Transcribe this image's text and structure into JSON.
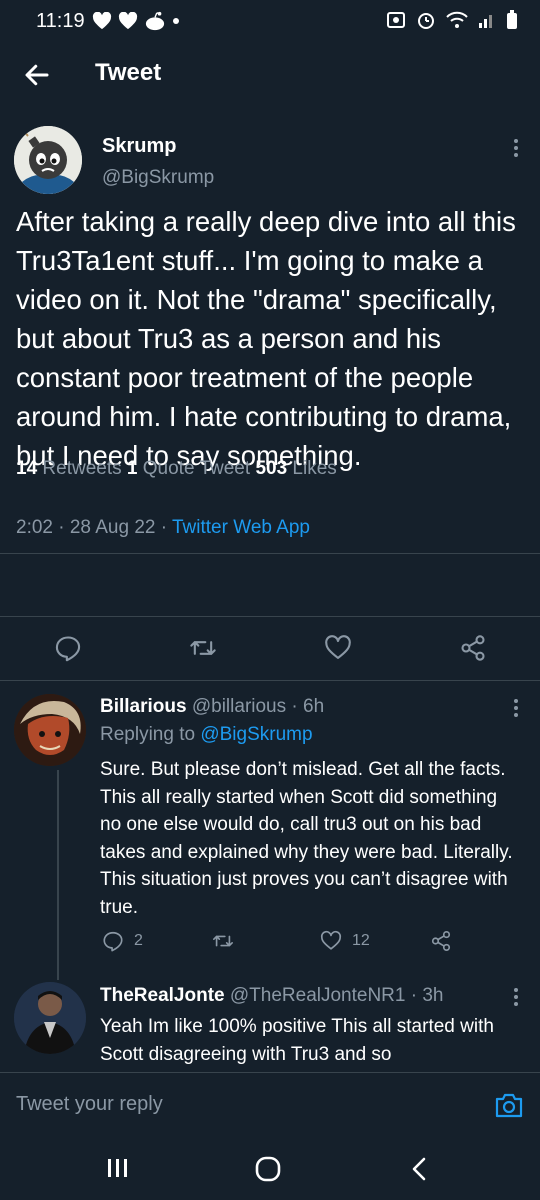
{
  "status_bar": {
    "time": "11:19"
  },
  "header": {
    "title": "Tweet"
  },
  "tweet": {
    "author_name": "Skrump",
    "author_handle": "@BigSkrump",
    "text": "After taking a really deep dive into all this Tru3Ta1ent stuff... I'm going to make a video on it. Not the \"drama\" specifically, but about Tru3 as a person and his constant poor treatment of the people around him. I hate contributing to drama, but I need to say something.",
    "timestamp": "2:02 · 28 Aug 22 · ",
    "app": "Twitter Web App",
    "retweets_count": "14",
    "retweets_label": " Retweets ",
    "quote_count": "1",
    "quote_label": " Quote Tweet ",
    "likes_count": "503",
    "likes_label": " Likes"
  },
  "replies": [
    {
      "name": "Billarious",
      "handle_time": " @billarious · 6h",
      "replying_prefix": "Replying to ",
      "replying_handle": "@BigSkrump",
      "text": "Sure. But please don’t mislead. Get all the facts. This all really started when Scott did something no one else would do, call tru3 out on his bad takes and explained why they were bad. Literally.  This situation just proves you can’t disagree with true.",
      "reply_count": "2",
      "like_count": "12"
    },
    {
      "name": "TheRealJonte",
      "handle_time": " @TheRealJonteNR1 · 3h",
      "text": "Yeah Im like 100% positive This all started with Scott disagreeing with Tru3 and so"
    }
  ],
  "composer": {
    "placeholder": "Tweet your reply"
  },
  "colors": {
    "background": "#15202b",
    "accent": "#1d9bf0",
    "muted": "#8b98a5",
    "divider": "#38444d"
  }
}
